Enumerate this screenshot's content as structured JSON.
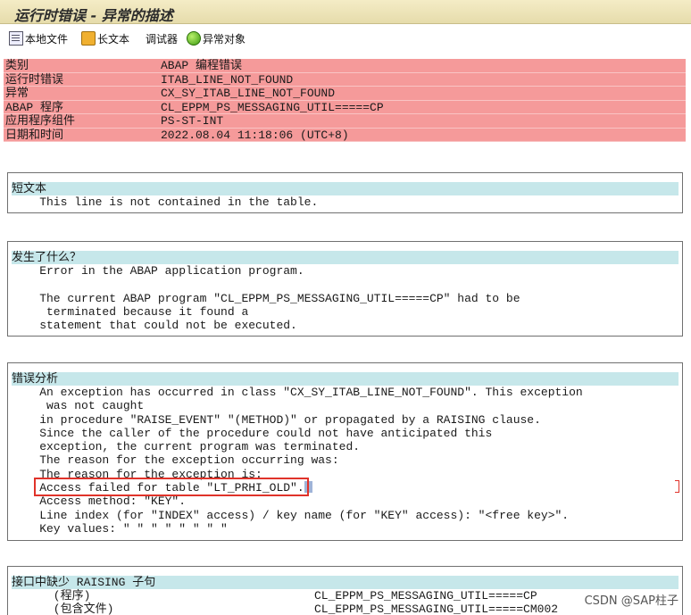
{
  "window": {
    "title": "运行时错误 - 异常的描述"
  },
  "toolbar": {
    "local_file": "本地文件",
    "long_text": "长文本",
    "debugger": "调试器",
    "exception_object": "异常对象"
  },
  "header": {
    "rows": [
      {
        "k": "类别",
        "v": "ABAP 编程错误"
      },
      {
        "k": "运行时错误",
        "v": "ITAB_LINE_NOT_FOUND"
      },
      {
        "k": "异常",
        "v": "CX_SY_ITAB_LINE_NOT_FOUND"
      },
      {
        "k": "ABAP 程序",
        "v": "CL_EPPM_PS_MESSAGING_UTIL=====CP"
      },
      {
        "k": "应用程序组件",
        "v": "PS-ST-INT"
      },
      {
        "k": "日期和时间",
        "v": "2022.08.04 11:18:06 (UTC+8)"
      }
    ]
  },
  "short_text": {
    "title": "短文本",
    "lines": [
      "    This line is not contained in the table."
    ]
  },
  "what_happened": {
    "title": "发生了什么？",
    "lines": [
      "    Error in the ABAP application program.",
      "",
      "    The current ABAP program \"CL_EPPM_PS_MESSAGING_UTIL=====CP\" had to be",
      "     terminated because it found a",
      "    statement that could not be executed."
    ]
  },
  "error_analysis": {
    "title": "错误分析",
    "lines": [
      "    An exception has occurred in class \"CX_SY_ITAB_LINE_NOT_FOUND\". This exception",
      "     was not caught",
      "    in procedure \"RAISE_EVENT\" \"(METHOD)\" or propagated by a RAISING clause.",
      "    Since the caller of the procedure could not have anticipated this",
      "    exception, the current program was terminated.",
      "    The reason for the exception occurring was:",
      "    The reason for the exception is:",
      "    Access failed for table \"LT_PRHI_OLD\".",
      "    Access method: \"KEY\".",
      "    Line index (for \"INDEX\" access) / key name (for \"KEY\" access): \"<free key>\".",
      "    Key values: \" \" \" \" \" \" \" \""
    ]
  },
  "missing_raising": {
    "title": "接口中缺少 RAISING 子句",
    "rows": [
      {
        "k": "      (程序)",
        "v": "CL_EPPM_PS_MESSAGING_UTIL=====CP"
      },
      {
        "k": "      (包含文件)",
        "v": "CL_EPPM_PS_MESSAGING_UTIL=====CM002"
      }
    ]
  },
  "watermark": "CSDN @SAP柱子"
}
